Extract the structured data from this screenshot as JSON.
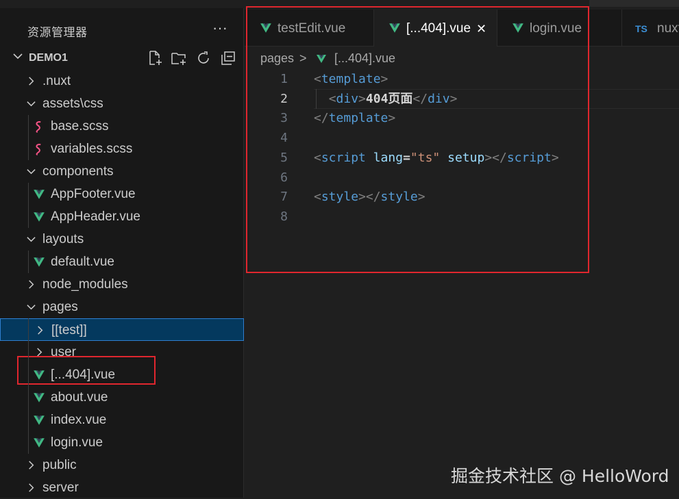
{
  "explorer": {
    "title": "资源管理器",
    "more_label": "···",
    "project_name": "DEMO1",
    "toolbar_icons": [
      "new-file-icon",
      "new-folder-icon",
      "refresh-icon",
      "collapse-all-icon"
    ],
    "tree": [
      {
        "label": ".nuxt",
        "type": "folder",
        "expanded": false,
        "depth": 1
      },
      {
        "label": "assets\\css",
        "type": "folder",
        "expanded": true,
        "depth": 1
      },
      {
        "label": "base.scss",
        "type": "scss",
        "depth": 2
      },
      {
        "label": "variables.scss",
        "type": "scss",
        "depth": 2
      },
      {
        "label": "components",
        "type": "folder",
        "expanded": true,
        "depth": 1
      },
      {
        "label": "AppFooter.vue",
        "type": "vue",
        "depth": 2
      },
      {
        "label": "AppHeader.vue",
        "type": "vue",
        "depth": 2
      },
      {
        "label": "layouts",
        "type": "folder",
        "expanded": true,
        "depth": 1
      },
      {
        "label": "default.vue",
        "type": "vue",
        "depth": 2
      },
      {
        "label": "node_modules",
        "type": "folder",
        "expanded": false,
        "depth": 1
      },
      {
        "label": "pages",
        "type": "folder",
        "expanded": true,
        "depth": 1
      },
      {
        "label": "[[test]]",
        "type": "folder",
        "expanded": false,
        "depth": 2,
        "selected": true
      },
      {
        "label": "user",
        "type": "folder",
        "expanded": false,
        "depth": 2
      },
      {
        "label": "[...404].vue",
        "type": "vue",
        "depth": 2
      },
      {
        "label": "about.vue",
        "type": "vue",
        "depth": 2
      },
      {
        "label": "index.vue",
        "type": "vue",
        "depth": 2
      },
      {
        "label": "login.vue",
        "type": "vue",
        "depth": 2
      },
      {
        "label": "public",
        "type": "folder",
        "expanded": false,
        "depth": 1
      },
      {
        "label": "server",
        "type": "folder",
        "expanded": false,
        "depth": 1
      }
    ]
  },
  "tabs": [
    {
      "label": "testEdit.vue",
      "type": "vue",
      "active": false
    },
    {
      "label": "[...404].vue",
      "type": "vue",
      "active": true,
      "close": "✕"
    },
    {
      "label": "login.vue",
      "type": "vue",
      "active": false
    },
    {
      "label": "nuxt",
      "type": "ts",
      "active": false,
      "icon_text": "TS"
    }
  ],
  "breadcrumb": {
    "folder": "pages",
    "separator": ">",
    "file": "[...404].vue"
  },
  "code": {
    "line_numbers": [
      "1",
      "2",
      "3",
      "4",
      "5",
      "6",
      "7",
      "8"
    ],
    "active_line": 2,
    "lines": [
      [
        {
          "t": "<",
          "c": "bracket"
        },
        {
          "t": "template",
          "c": "tag"
        },
        {
          "t": ">",
          "c": "bracket"
        }
      ],
      [
        {
          "t": "  ",
          "c": "plain"
        },
        {
          "t": "<",
          "c": "bracket"
        },
        {
          "t": "div",
          "c": "tag"
        },
        {
          "t": ">",
          "c": "bracket"
        },
        {
          "t": "404页面",
          "c": "plain"
        },
        {
          "t": "</",
          "c": "bracket"
        },
        {
          "t": "div",
          "c": "tag"
        },
        {
          "t": ">",
          "c": "bracket"
        }
      ],
      [
        {
          "t": "</",
          "c": "bracket"
        },
        {
          "t": "template",
          "c": "tag"
        },
        {
          "t": ">",
          "c": "bracket"
        }
      ],
      [],
      [
        {
          "t": "<",
          "c": "bracket"
        },
        {
          "t": "script",
          "c": "tag"
        },
        {
          "t": " ",
          "c": "plain"
        },
        {
          "t": "lang",
          "c": "attr"
        },
        {
          "t": "=",
          "c": "plain"
        },
        {
          "t": "\"ts\"",
          "c": "str"
        },
        {
          "t": " ",
          "c": "plain"
        },
        {
          "t": "setup",
          "c": "attr"
        },
        {
          "t": "></",
          "c": "bracket"
        },
        {
          "t": "script",
          "c": "tag"
        },
        {
          "t": ">",
          "c": "bracket"
        }
      ],
      [],
      [
        {
          "t": "<",
          "c": "bracket"
        },
        {
          "t": "style",
          "c": "tag"
        },
        {
          "t": "></",
          "c": "bracket"
        },
        {
          "t": "style",
          "c": "tag"
        },
        {
          "t": ">",
          "c": "bracket"
        }
      ],
      []
    ]
  },
  "colors": {
    "highlight_box": "#e0262e",
    "vue_icon": "#41b883",
    "scss_icon": "#f55385",
    "ts_icon": "#3c8fd6",
    "selected_row": "#04395e"
  },
  "watermark": "掘金技术社区 @ HelloWord"
}
